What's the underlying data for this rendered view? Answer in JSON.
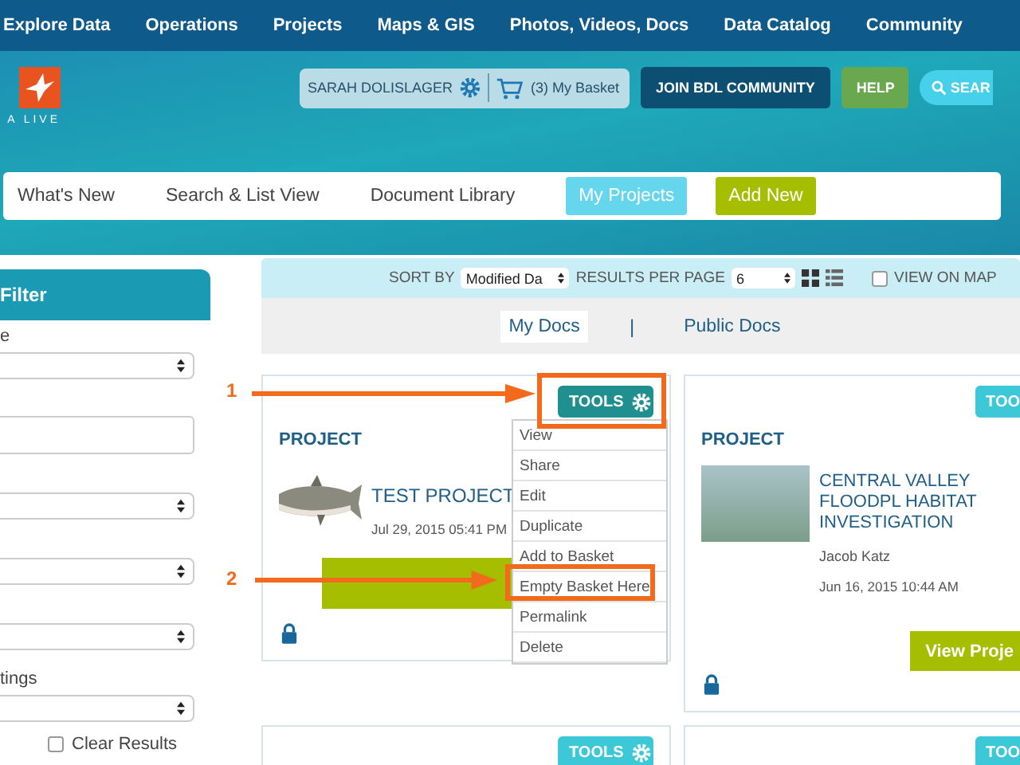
{
  "top_nav": [
    "Explore Data",
    "Operations",
    "Projects",
    "Maps & GIS",
    "Photos, Videos, Docs",
    "Data Catalog",
    "Community"
  ],
  "logo": {
    "text": "A LIVE"
  },
  "header": {
    "user": "SARAH DOLISLAGER",
    "basket": "(3) My Basket",
    "join_button": "JOIN BDL COMMUNITY",
    "help_button": "HELP",
    "search_button": "SEAR"
  },
  "subnav": [
    {
      "label": "What's New",
      "kind": "link",
      "selected": false
    },
    {
      "label": "Search & List View",
      "kind": "link",
      "selected": false
    },
    {
      "label": "Document Library",
      "kind": "link",
      "selected": false
    },
    {
      "label": "My Projects",
      "kind": "link",
      "selected": true
    },
    {
      "label": "Add New",
      "kind": "button",
      "selected": false
    }
  ],
  "filter": {
    "title": "Filter",
    "fields": [
      {
        "kind": "select",
        "label": "e"
      },
      {
        "kind": "input"
      },
      {
        "kind": "select"
      },
      {
        "kind": "select"
      },
      {
        "kind": "select"
      },
      {
        "kind": "select",
        "label": "tings"
      }
    ],
    "clear": {
      "label": "Clear Results",
      "checked": false
    }
  },
  "toolbar": {
    "sort_label": "SORT BY",
    "sort_value": "Modified Da",
    "per_page_label": "RESULTS PER PAGE",
    "per_page_value": "6",
    "map": {
      "label": "VIEW ON MAP",
      "checked": false
    }
  },
  "doc_tab_separator": "|",
  "doc_tabs": [
    {
      "label": "My Docs",
      "selected": true
    },
    {
      "label": "Public Docs",
      "selected": false
    }
  ],
  "cards": [
    {
      "type": "PROJECT",
      "title": "TEST PROJECT",
      "date": "Jul 29, 2015 05:41 PM",
      "tools": "TOOLS",
      "gear": true,
      "tools_open": true
    },
    {
      "type": "PROJECT",
      "title": "CENTRAL VALLEY FLOODPL HABITAT INVESTIGATION",
      "author": "Jacob Katz",
      "date": "Jun 16, 2015 10:44 AM",
      "tools": "TOO",
      "gear": false,
      "tools_open": false,
      "button": "View Proje"
    }
  ],
  "more_cards": [
    {
      "tools": "TOOLS",
      "gear": true
    },
    {
      "tools": "TOO",
      "gear": false
    }
  ],
  "tools_menu": [
    "View",
    "Share",
    "Edit",
    "Duplicate",
    "Add to Basket",
    "Empty Basket Here",
    "Permalink",
    "Delete"
  ],
  "annotations": [
    {
      "label": "1"
    },
    {
      "label": "2"
    }
  ]
}
